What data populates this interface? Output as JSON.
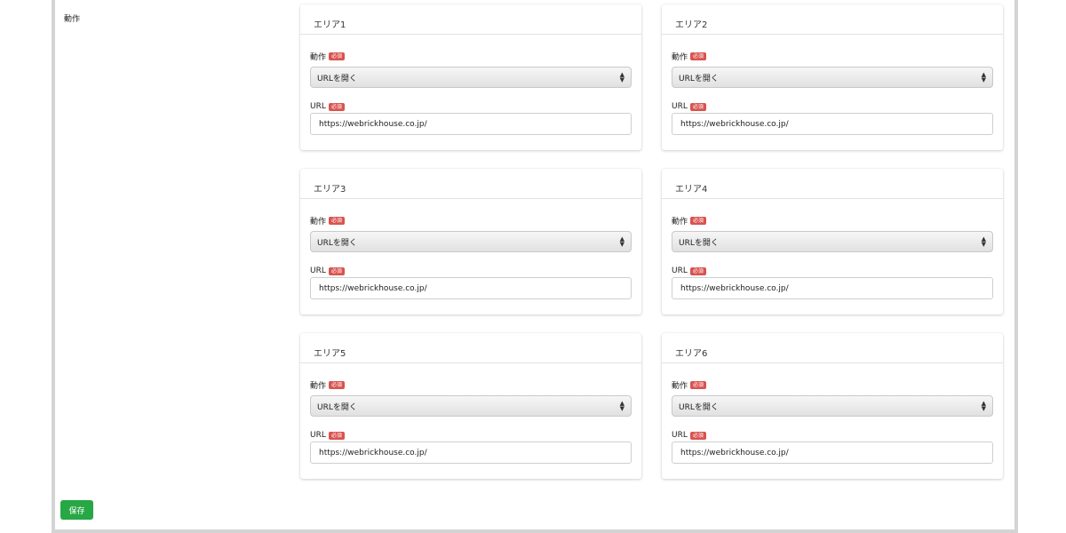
{
  "section_label": "動作",
  "areas": [
    {
      "title": "エリア1",
      "action_label": "動作",
      "action_required": "必須",
      "action_value": "URLを開く",
      "url_label": "URL",
      "url_required": "必須",
      "url_value": "https://webrickhouse.co.jp/"
    },
    {
      "title": "エリア2",
      "action_label": "動作",
      "action_required": "必須",
      "action_value": "URLを開く",
      "url_label": "URL",
      "url_required": "必須",
      "url_value": "https://webrickhouse.co.jp/"
    },
    {
      "title": "エリア3",
      "action_label": "動作",
      "action_required": "必須",
      "action_value": "URLを開く",
      "url_label": "URL",
      "url_required": "必須",
      "url_value": "https://webrickhouse.co.jp/"
    },
    {
      "title": "エリア4",
      "action_label": "動作",
      "action_required": "必須",
      "action_value": "URLを開く",
      "url_label": "URL",
      "url_required": "必須",
      "url_value": "https://webrickhouse.co.jp/"
    },
    {
      "title": "エリア5",
      "action_label": "動作",
      "action_required": "必須",
      "action_value": "URLを開く",
      "url_label": "URL",
      "url_required": "必須",
      "url_value": "https://webrickhouse.co.jp/"
    },
    {
      "title": "エリア6",
      "action_label": "動作",
      "action_required": "必須",
      "action_value": "URLを開く",
      "url_label": "URL",
      "url_required": "必須",
      "url_value": "https://webrickhouse.co.jp/"
    }
  ],
  "save_label": "保存",
  "colors": {
    "required_badge": "#d9534f",
    "save_button": "#28a745"
  }
}
